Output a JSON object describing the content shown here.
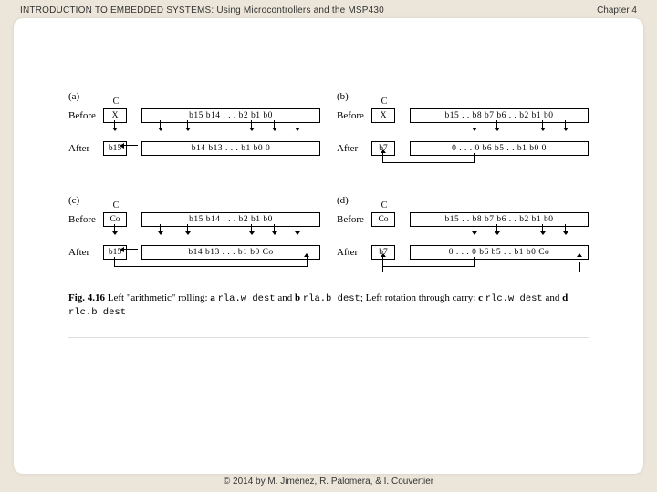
{
  "header": {
    "title": "INTRODUCTION TO EMBEDDED SYSTEMS: Using Microcontrollers and the MSP430",
    "chapter": "Chapter 4"
  },
  "footer": {
    "copyright": "© 2014 by M. Jiménez, R. Palomera, & I. Couvertier"
  },
  "figure": {
    "labels": {
      "a": "(a)",
      "b": "(b)",
      "c": "(c)",
      "d": "(d)",
      "before": "Before",
      "after": "After",
      "c_header": "C"
    },
    "panel_a": {
      "before_c": "X",
      "before_reg": "b15  b14  .  .  .  b2  b1  b0",
      "after_c": "b15",
      "after_reg": "b14  b13  .  .  .  b1  b0   0"
    },
    "panel_b": {
      "before_c": "X",
      "before_reg": "b15 . . b8  b7  b6 . . b2  b1  b0",
      "after_c": "b7",
      "after_reg": "0 . . . 0  b6  b5 . . b1  b0  0"
    },
    "panel_c": {
      "before_c": "Co",
      "before_reg": "b15  b14  .  .  .  b2  b1  b0",
      "after_c": "b15",
      "after_reg": "b14  b13  .  .  .  b1  b0  Co"
    },
    "panel_d": {
      "before_c": "Co",
      "before_reg": "b15 . . b8  b7  b6 . . b2  b1  b0",
      "after_c": "b7",
      "after_reg": "0 . . . 0  b6  b5 . . b1  b0  Co"
    },
    "caption": {
      "fignum": "Fig. 4.16",
      "t1": "  Left \"arithmetic\" rolling: ",
      "bold_a": "a ",
      "code_a": "rla.w  dest",
      "t2": " and ",
      "bold_b": "b ",
      "code_b": "rla.b  dest",
      "t3": "; Left rotation through carry: ",
      "bold_c": "c ",
      "code_c": "rlc.w  dest",
      "t4": " and ",
      "bold_d": "d ",
      "code_d": "rlc.b  dest"
    }
  }
}
